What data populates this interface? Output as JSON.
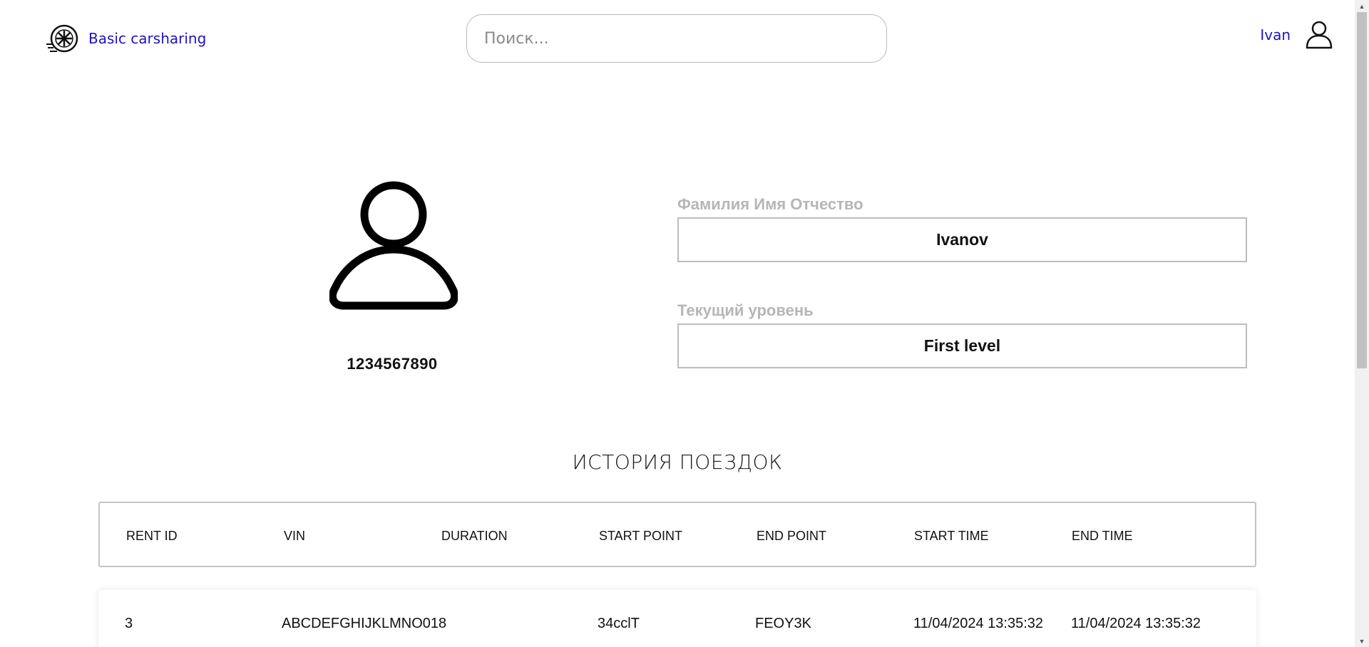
{
  "header": {
    "brand": "Basic carsharing",
    "logo_icon": "wheel-icon",
    "search_placeholder": "Поиск...",
    "user_name": "Ivan",
    "user_icon": "user-icon"
  },
  "profile": {
    "avatar_icon": "user-icon",
    "phone": "1234567890",
    "name_label": "Фамилия Имя Отчество",
    "name_value": "Ivanov",
    "level_label": "Текущий уровень",
    "level_value": "First level"
  },
  "history": {
    "title": "ИСТОРИЯ ПОЕЗДОК",
    "columns": [
      "RENT ID",
      "VIN",
      "DURATION",
      "START POINT",
      "END POINT",
      "START TIME",
      "END TIME"
    ],
    "rows": [
      {
        "rent_id": "3",
        "vin": "ABCDEFGHIJKLMNO018",
        "duration": "",
        "start_point": "34cclT",
        "end_point": "FEOY3K",
        "start_time": "11/04/2024 13:35:32",
        "end_time": "11/04/2024 13:35:32"
      }
    ]
  },
  "colors": {
    "link": "#1f13c4",
    "label": "#b6b6b6",
    "border": "#bdbdbd"
  }
}
